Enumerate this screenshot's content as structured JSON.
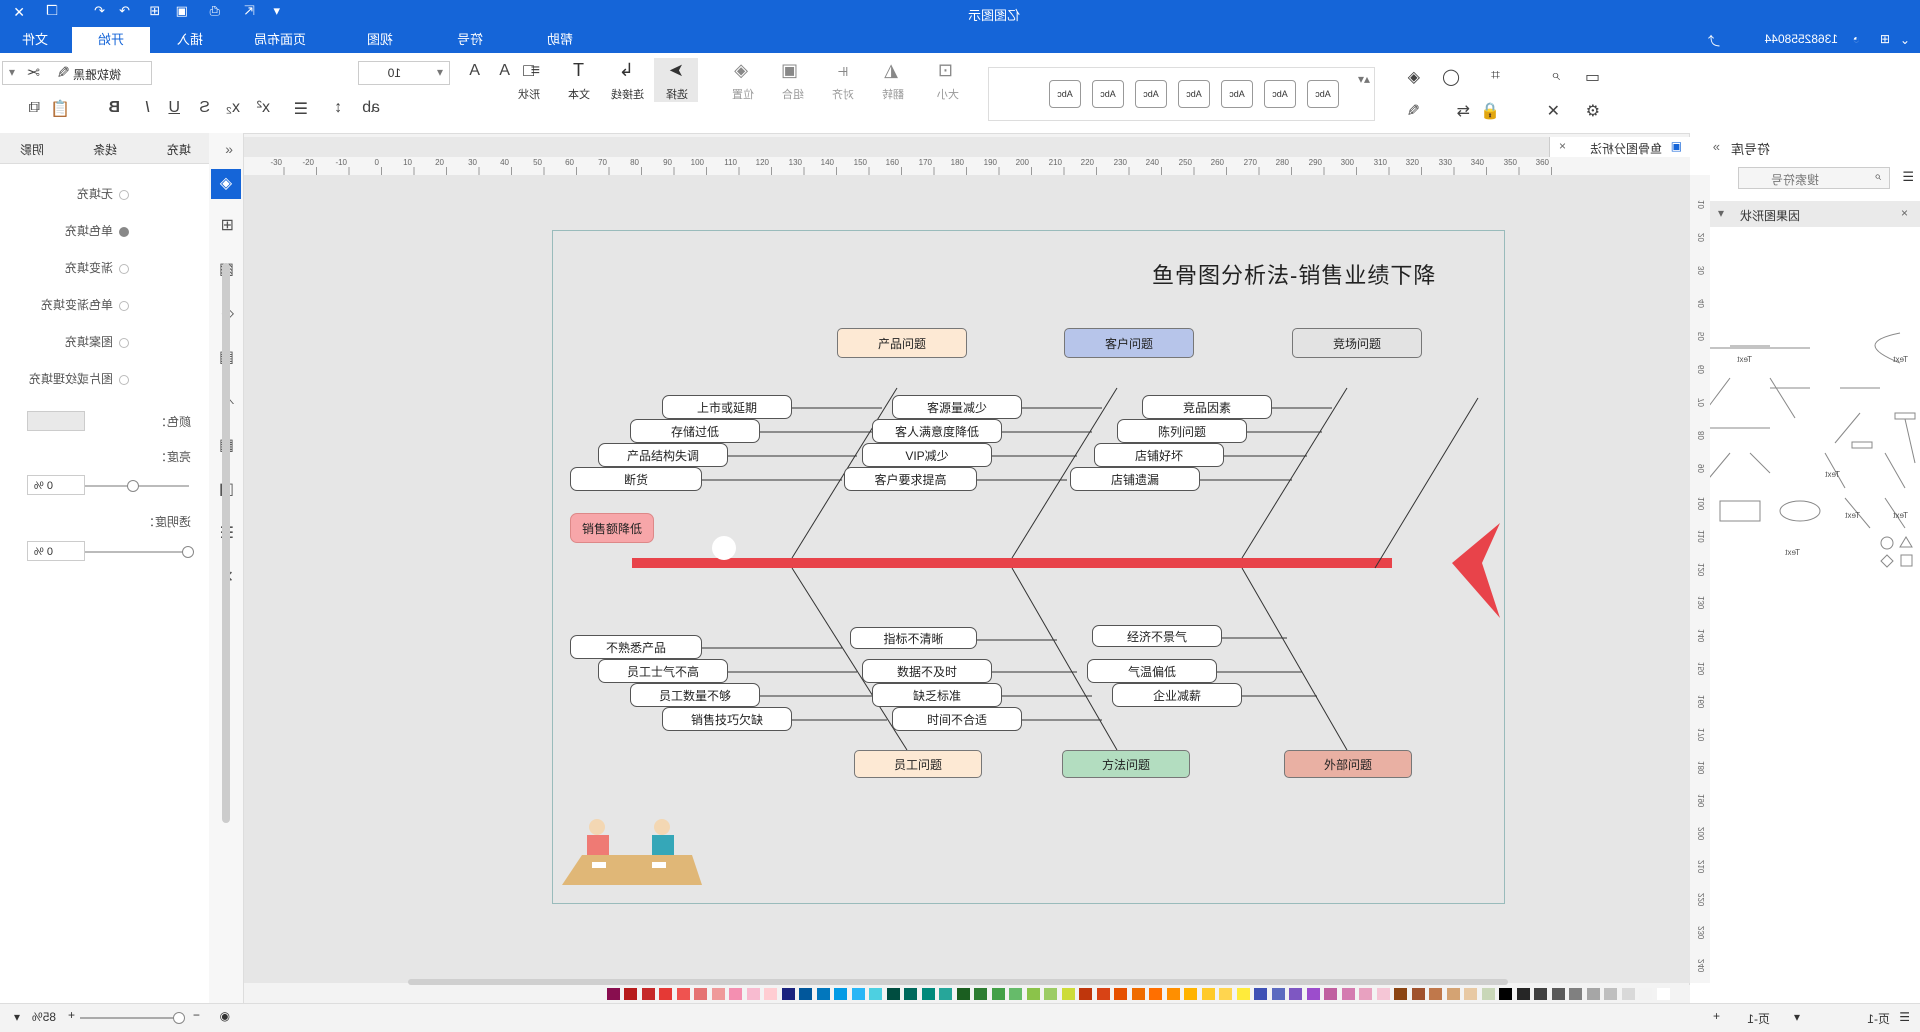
{
  "app": {
    "title": "亿图图示",
    "phone": "13682558044"
  },
  "menu": {
    "tabs": [
      "文件",
      "开始",
      "插入",
      "页面布局",
      "视图",
      "符号",
      "帮助"
    ],
    "active": "开始"
  },
  "toolbar": {
    "font_name": "微软雅黑",
    "font_size": "10",
    "buttons": [
      "形状",
      "文本",
      "连接线",
      "选择",
      "位置",
      "组合",
      "对齐",
      "翻转",
      "大小"
    ],
    "style_label": "Abc"
  },
  "left_panel": {
    "tabs": [
      "填充",
      "线条",
      "阴影"
    ],
    "fill_options": [
      "无填充",
      "单色填充",
      "渐变填充",
      "单色渐变填充",
      "图案填充",
      "图片或纹理填充"
    ],
    "selected_fill": "单色填充",
    "color_label": "颜色：",
    "shade_label": "亮度：",
    "shade_value": "0 %",
    "transparency_label": "透明度：",
    "transparency_value": "0 %"
  },
  "doc_tab": {
    "name": "鱼骨图分析法"
  },
  "ruler": {
    "h_labels": [
      "-30",
      "-20",
      "-10",
      "0",
      "10",
      "20",
      "30",
      "40",
      "50",
      "60",
      "70",
      "80",
      "90",
      "100",
      "110",
      "120",
      "130",
      "140",
      "150",
      "160",
      "170",
      "180",
      "190",
      "200",
      "210",
      "220",
      "230",
      "240",
      "250",
      "260",
      "270",
      "280",
      "290",
      "300",
      "310",
      "320",
      "330",
      "340",
      "350",
      "360"
    ],
    "v_labels": [
      "10",
      "20",
      "30",
      "40",
      "50",
      "60",
      "70",
      "80",
      "90",
      "100",
      "110",
      "120",
      "130",
      "140",
      "150",
      "160",
      "170",
      "180",
      "190",
      "200",
      "210",
      "220",
      "230",
      "240"
    ]
  },
  "diagram": {
    "title": "鱼骨图分析法-销售业绩下降",
    "head_label": "销售额降低",
    "categories_top": [
      "产品问题",
      "客户问题",
      "竞场问题"
    ],
    "categories_bottom": [
      "员工问题",
      "方法问题",
      "外部问题"
    ],
    "causes": {
      "product": [
        "上市或延期",
        "存储过低",
        "产品结构失调",
        "断货"
      ],
      "customer": [
        "客源量减少",
        "客人满意度降低",
        "VIP减少",
        "客户要求提高"
      ],
      "market": [
        "竞品因素",
        "陈列问题",
        "店铺好坏",
        "店铺遗漏"
      ],
      "staff": [
        "不熟悉产品",
        "员工士气不高",
        "员工数量不够",
        "销售技巧欠缺"
      ],
      "method": [
        "指标不清晰",
        "数据不及时",
        "缺乏标准",
        "时间不合适"
      ],
      "external": [
        "经济不景气",
        "气温偏低",
        "企业减薪"
      ]
    }
  },
  "library": {
    "title": "符号库",
    "search_placeholder": "搜索符号",
    "section": "因果图形状",
    "text_label": "Text"
  },
  "status": {
    "page_label": "页-1",
    "page_tab": "页-1",
    "zoom": "85%"
  },
  "colors": {
    "accent": "#1565d8",
    "fish": "#e8434a",
    "page_bg": "#cfe2f7",
    "head_box": "#f7a6a9",
    "cat_product": "#fde9d4",
    "cat_customer": "#b7c5ea",
    "cat_market": "#e3e3e3",
    "cat_staff": "#fde9d4",
    "cat_method": "#b3ddc0",
    "cat_external": "#e9b0a3"
  },
  "icons": [
    "close-icon",
    "restore-icon",
    "bell-icon",
    "gear-icon",
    "undo-icon",
    "redo-icon",
    "save-icon",
    "print-icon",
    "search-icon",
    "fill-icon",
    "layers-icon",
    "table-icon"
  ]
}
